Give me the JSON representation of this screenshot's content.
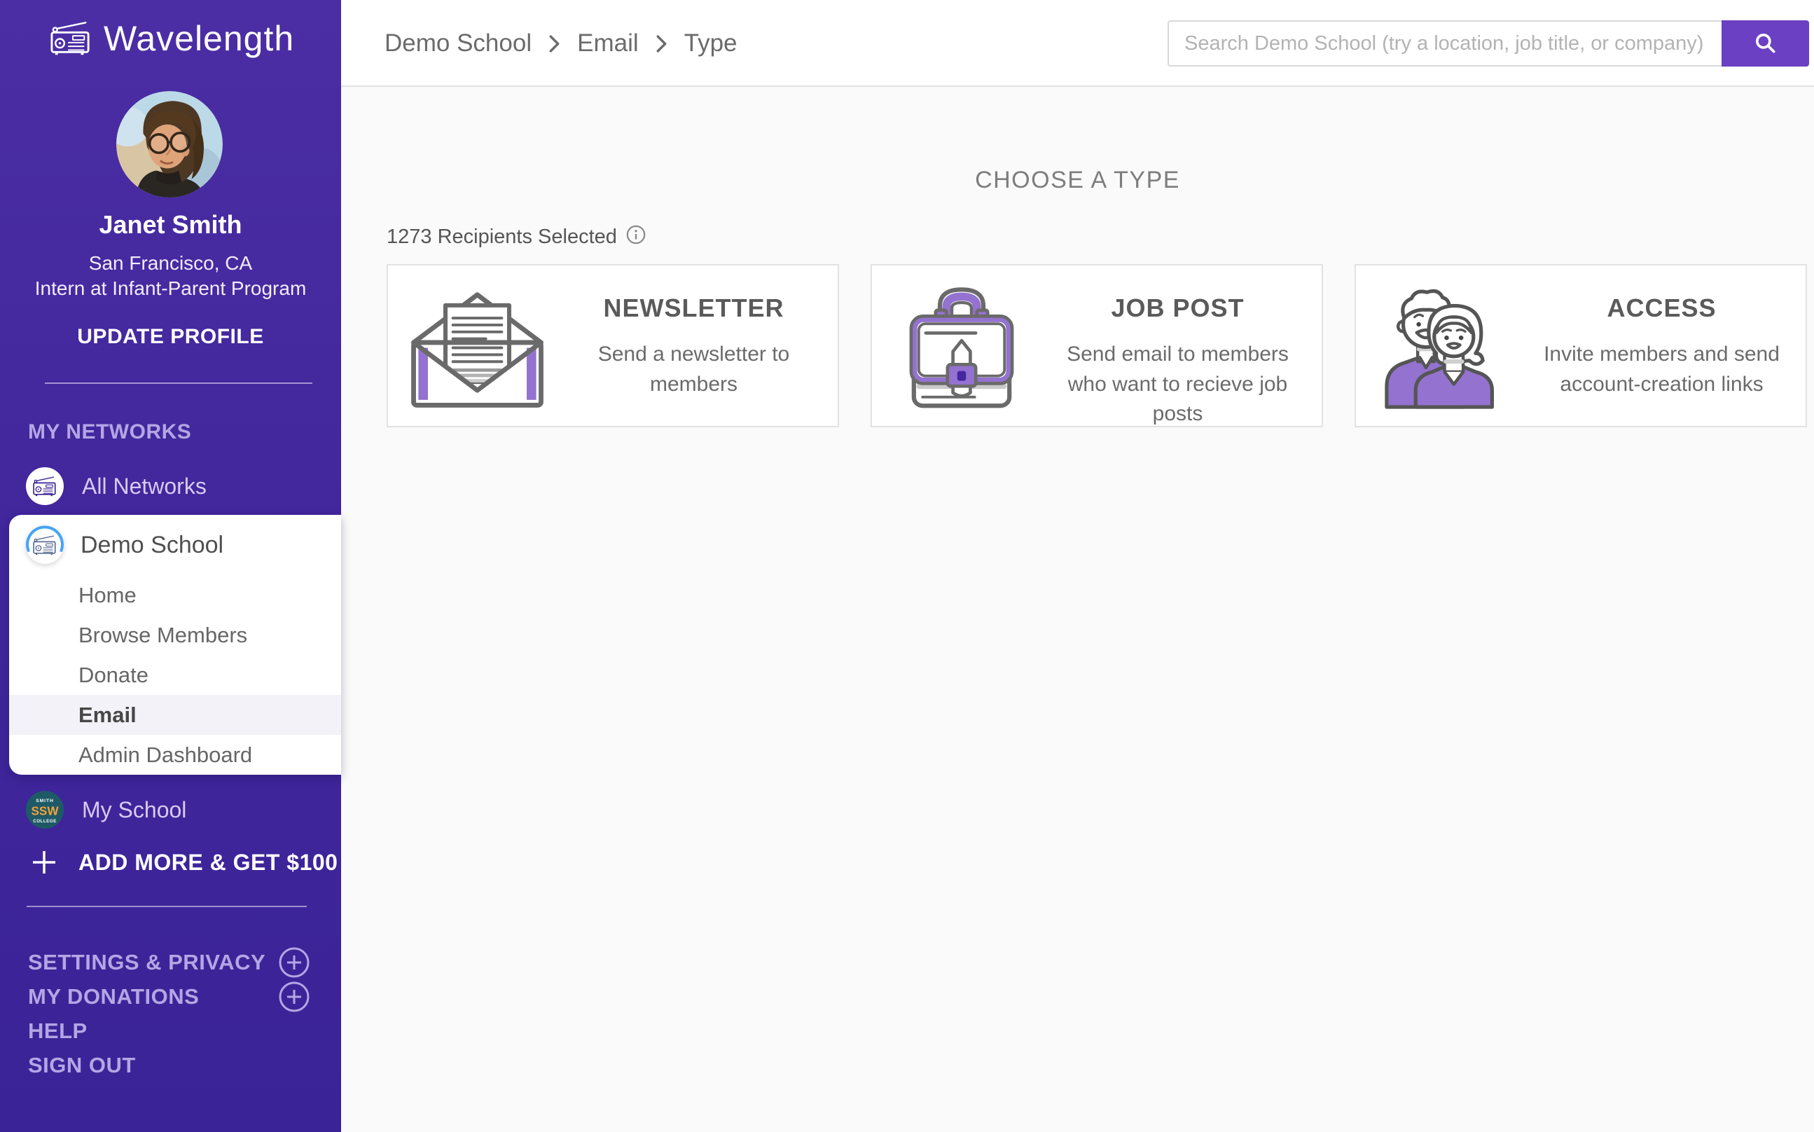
{
  "app": {
    "name": "Wavelength"
  },
  "sidebar": {
    "profile": {
      "name": "Janet Smith",
      "location": "San Francisco, CA",
      "role": "Intern at Infant-Parent Program",
      "update_label": "UPDATE PROFILE"
    },
    "my_networks_label": "MY NETWORKS",
    "all_networks_label": "All Networks",
    "network_menu": {
      "title": "Demo School",
      "items": [
        {
          "label": "Home",
          "active": false
        },
        {
          "label": "Browse Members",
          "active": false
        },
        {
          "label": "Donate",
          "active": false
        },
        {
          "label": "Email",
          "active": true
        },
        {
          "label": "Admin Dashboard",
          "active": false
        }
      ]
    },
    "my_school_label": "My School",
    "school_badge": {
      "top": "SMITH",
      "middle": "SSW",
      "bottom": "COLLEGE"
    },
    "add_more_label": "ADD MORE & GET $100",
    "footer_links": [
      {
        "label": "SETTINGS & PRIVACY",
        "has_plus": true
      },
      {
        "label": "MY DONATIONS",
        "has_plus": true
      },
      {
        "label": "HELP",
        "has_plus": false
      },
      {
        "label": "SIGN OUT",
        "has_plus": false
      }
    ]
  },
  "header": {
    "breadcrumb": [
      "Demo School",
      "Email",
      "Type"
    ],
    "search": {
      "placeholder": "Search Demo School (try a location, job title, or company)"
    }
  },
  "main": {
    "title": "CHOOSE A TYPE",
    "recipients_text": "1273 Recipients Selected",
    "cards": [
      {
        "id": "newsletter",
        "title": "NEWSLETTER",
        "description": "Send a newsletter to members"
      },
      {
        "id": "job-post",
        "title": "JOB POST",
        "description": "Send email to members who want to recieve job posts"
      },
      {
        "id": "access",
        "title": "ACCESS",
        "description": "Invite members and send account-creation links"
      }
    ]
  },
  "colors": {
    "sidebar_purple": "#42279d",
    "accent_purple": "#6b40c2",
    "icon_purple": "#9472cf",
    "blue_arc": "#45a4f5",
    "badge_teal": "#1e5a66",
    "badge_orange": "#f2a23b",
    "content_bg": "#fafafa"
  }
}
